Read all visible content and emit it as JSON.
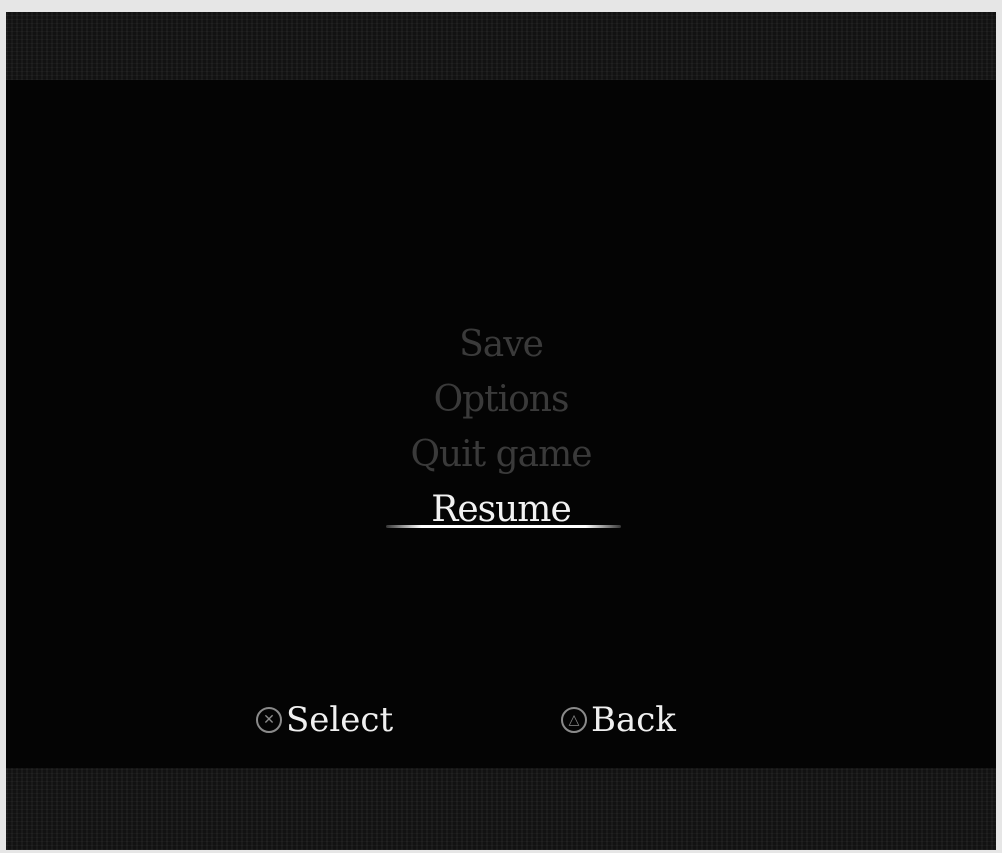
{
  "pause_menu": {
    "items": [
      {
        "label": "Save",
        "selected": false
      },
      {
        "label": "Options",
        "selected": false
      },
      {
        "label": "Quit game",
        "selected": false
      },
      {
        "label": "Resume",
        "selected": true
      }
    ]
  },
  "controls": {
    "select": {
      "icon": "cross-button-icon",
      "glyph": "✕",
      "label": "Select"
    },
    "back": {
      "icon": "triangle-button-icon",
      "glyph": "△",
      "label": "Back"
    }
  }
}
